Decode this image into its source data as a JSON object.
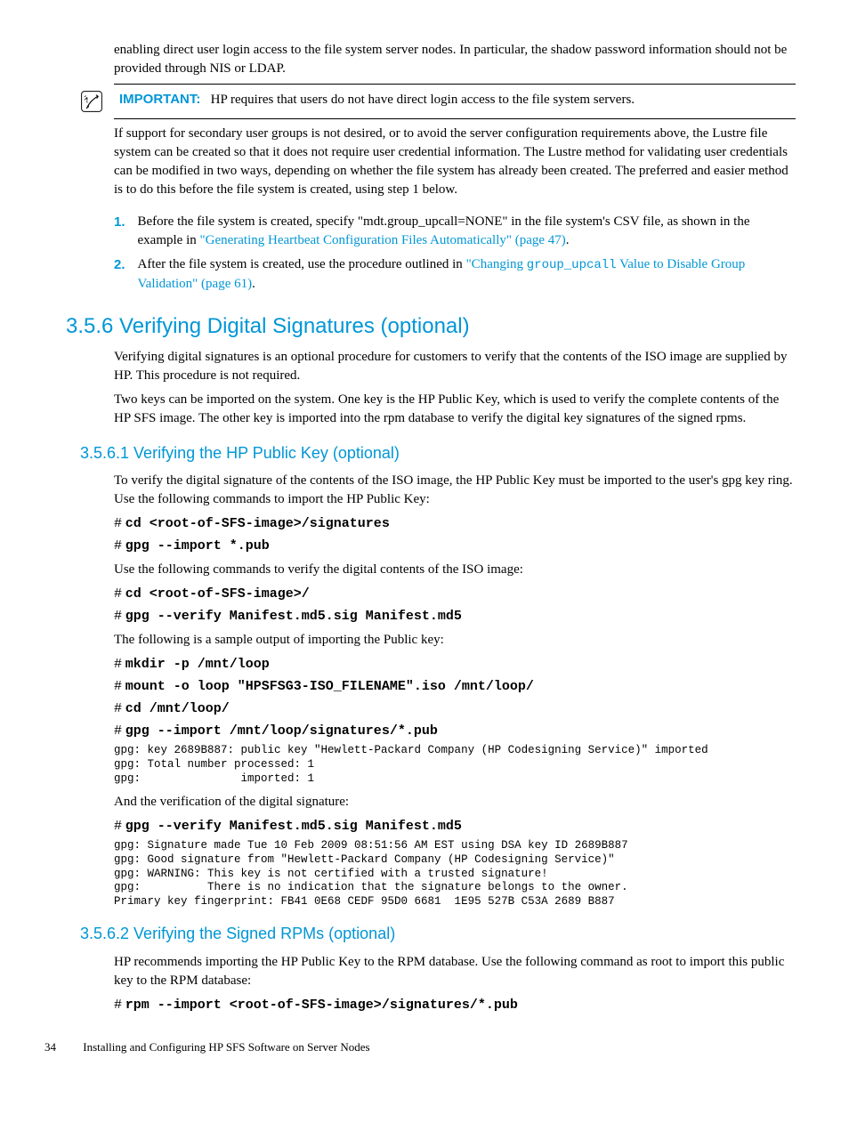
{
  "para": {
    "intro": "enabling direct user login access to the file system server nodes. In particular, the shadow password information should not be provided through NIS or LDAP.",
    "important_label": "IMPORTANT:",
    "important_text": "HP requires that users do not have direct login access to the file system servers.",
    "support": "If support for secondary user groups is not desired, or to avoid the server configuration requirements above, the Lustre file system can be created so that it does not require user credential information. The Lustre method for validating user credentials can be modified in two ways, depending on whether the file system has already been created. The preferred and easier method is to do this before the file system is created, using step 1 below.",
    "step1_a": "Before the file system is created, specify \"mdt.group_upcall=NONE\" in the file system's CSV file, as shown in the example in ",
    "step1_link": "\"Generating Heartbeat Configuration Files Automatically\" (page 47)",
    "step1_b": ".",
    "step2_a": "After the file system is created, use the procedure outlined in ",
    "step2_link_a": "\"Changing ",
    "step2_mono": "group_upcall",
    "step2_link_b": " Value to Disable Group Validation\" (page 61)",
    "step2_b": "."
  },
  "sec356": {
    "title": "3.5.6 Verifying Digital Signatures (optional)",
    "p1": "Verifying digital signatures is an optional procedure for customers to verify that the contents of the ISO image are supplied by HP. This procedure is not required.",
    "p2": "Two keys can be imported on the system. One key is the HP Public Key, which is used to verify the complete contents of the HP SFS image. The other key is imported into the rpm database to verify the digital key signatures of the signed rpms."
  },
  "sec3561": {
    "title": "3.5.6.1 Verifying the HP Public Key (optional)",
    "p1": "To verify the digital signature of the contents of the ISO image, the HP Public Key must be imported to the user's gpg key ring. Use the following commands to import the HP Public Key:",
    "cmd1": "cd <root-of-SFS-image>/signatures",
    "cmd2": "gpg --import *.pub",
    "p2": "Use the following commands to verify the digital contents of the ISO image:",
    "cmd3": "cd <root-of-SFS-image>/",
    "cmd4": "gpg --verify Manifest.md5.sig Manifest.md5",
    "p3": "The following is a sample output of importing the Public key:",
    "cmd5": "mkdir -p /mnt/loop",
    "cmd6": "mount -o loop \"HPSFSG3-ISO_FILENAME\".iso /mnt/loop/",
    "cmd7": "cd /mnt/loop/",
    "cmd8": "gpg --import /mnt/loop/signatures/*.pub",
    "out1": "gpg: key 2689B887: public key \"Hewlett-Packard Company (HP Codesigning Service)\" imported\ngpg: Total number processed: 1\ngpg:               imported: 1",
    "p4": "And the verification of the digital signature:",
    "cmd9": "gpg --verify Manifest.md5.sig Manifest.md5",
    "out2": "gpg: Signature made Tue 10 Feb 2009 08:51:56 AM EST using DSA key ID 2689B887\ngpg: Good signature from \"Hewlett-Packard Company (HP Codesigning Service)\"\ngpg: WARNING: This key is not certified with a trusted signature!\ngpg:          There is no indication that the signature belongs to the owner.\nPrimary key fingerprint: FB41 0E68 CEDF 95D0 6681  1E95 527B C53A 2689 B887"
  },
  "sec3562": {
    "title": "3.5.6.2 Verifying the Signed RPMs (optional)",
    "p1": "HP recommends importing the HP Public Key to the RPM database. Use the following command as root to import this public key to the RPM database:",
    "cmd1": "rpm --import <root-of-SFS-image>/signatures/*.pub"
  },
  "footer": {
    "page": "34",
    "title": "Installing and Configuring HP SFS Software on Server Nodes"
  },
  "nums": {
    "one": "1.",
    "two": "2."
  },
  "hash": "#"
}
